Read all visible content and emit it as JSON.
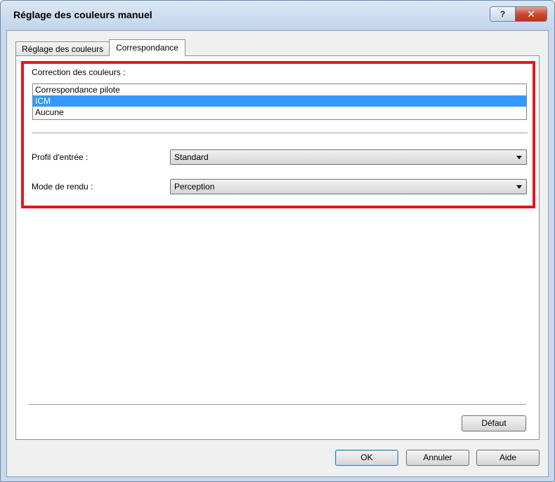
{
  "window": {
    "title": "Réglage des couleurs manuel",
    "help_symbol": "?",
    "close_symbol": "✕"
  },
  "tabs": [
    {
      "label": "Réglage des couleurs",
      "active": false
    },
    {
      "label": "Correspondance",
      "active": true
    }
  ],
  "color_correction": {
    "label": "Correction des couleurs :",
    "items": [
      "Correspondance pilote",
      "ICM",
      "Aucune"
    ],
    "selected": "ICM"
  },
  "input_profile": {
    "label": "Profil d'entrée :",
    "value": "Standard"
  },
  "rendering_mode": {
    "label": "Mode de rendu :",
    "value": "Perception"
  },
  "buttons": {
    "default_label": "Défaut",
    "ok_label": "OK",
    "cancel_label": "Annuler",
    "help_label": "Aide"
  },
  "colors": {
    "highlight_border": "#e8141e",
    "selection": "#3399ff"
  }
}
